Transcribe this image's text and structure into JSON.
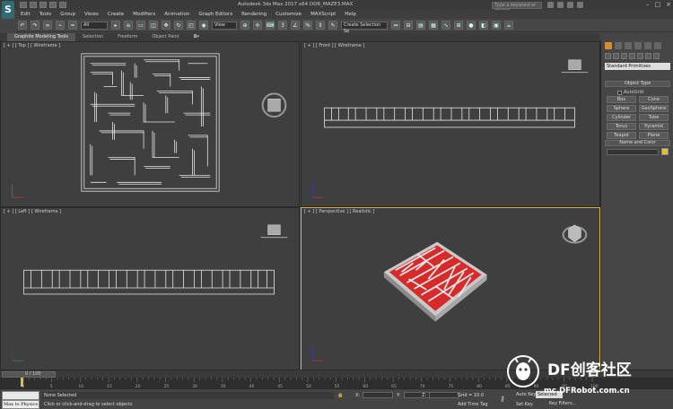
{
  "titlebar": {
    "title": "Autodesk 3ds Max 2017 x64    DDR_MAZE3.MAX",
    "search_placeholder": "Type a keyword or phrase",
    "app_logo_icon": "3ds-max-logo-icon"
  },
  "menu": [
    "Edit",
    "Tools",
    "Group",
    "Views",
    "Create",
    "Modifiers",
    "Animation",
    "Graph Editors",
    "Rendering",
    "Customize",
    "MAXScript",
    "Help"
  ],
  "toolbar": {
    "selection_filter": "All",
    "reference_coord": "View",
    "named_selection": "Create Selection Se"
  },
  "ribbon": {
    "tabs": [
      "Graphite Modeling Tools",
      "Selection",
      "Freeform",
      "Object Paint"
    ]
  },
  "viewports": {
    "top": "[ + ] [ Top ] [ Wireframe ]",
    "front": "[ + ] [ Front ] [ Wireframe ]",
    "left": "[ + ] [ Left ] [ Wireframe ]",
    "perspective": "[ + ] [ Perspective ] [ Realistic ]"
  },
  "command_panel": {
    "category": "Standard Primitives",
    "object_type_title": "Object Type",
    "autogrid_label": "AutoGrid",
    "primitives": [
      "Box",
      "Cone",
      "Sphere",
      "GeoSphere",
      "Cylinder",
      "Tube",
      "Torus",
      "Pyramid",
      "Teapot",
      "Plane"
    ],
    "name_color_title": "Name and Color",
    "swatch_color": "#e0c23a"
  },
  "timeline": {
    "frame_label": "0 / 100",
    "ticks": [
      "0",
      "5",
      "10",
      "15",
      "20",
      "25",
      "30",
      "35",
      "40",
      "45",
      "50",
      "55",
      "60",
      "65",
      "70",
      "75",
      "80",
      "85",
      "90",
      "95",
      "100"
    ]
  },
  "status": {
    "maxscript_text": "Max to Physics c",
    "selection_status": "None Selected",
    "prompt": "Click or click-and-drag to select objects",
    "x_label": "X:",
    "y_label": "Y:",
    "z_label": "Z:",
    "grid": "Grid = 10.0",
    "add_time_tag": "Add Time Tag",
    "auto_key": "Auto Key",
    "set_key": "Set Key",
    "key_mode": "Selected",
    "key_filters": "Key Filters..."
  },
  "watermark": {
    "brand": "DF创客社区",
    "url": "mc.DFRobot.com.cn"
  },
  "colors": {
    "active_viewport_border": "#d4b44a",
    "maze_red": "#d82a2a",
    "wireframe": "#e6e6e6"
  }
}
